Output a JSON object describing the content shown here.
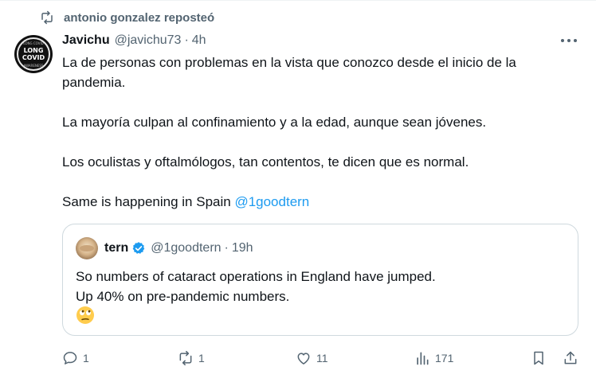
{
  "repost": {
    "icon": "repost-icon",
    "text": "antonio gonzalez reposteó"
  },
  "avatar": {
    "line1": "LONG",
    "line2": "COVID",
    "micro_top": "LONG COVID",
    "micro_bottom": "AWARENESS"
  },
  "tweet": {
    "display_name": "Javichu",
    "handle": "@javichu73",
    "separator": "·",
    "time": "4h",
    "paragraphs": [
      "La de personas con problemas en la vista que conozco desde el inicio de la pandemia.",
      "La mayoría culpan al confinamiento y a la edad, aunque sean jóvenes.",
      "Los oculistas y oftalmólogos, tan contentos, te dicen que es normal."
    ],
    "last_line_text": "Same is happening in Spain ",
    "mention": "@1goodtern"
  },
  "quote": {
    "display_name": "tern",
    "verified_icon": "verified-badge-icon",
    "handle": "@1goodtern",
    "separator": "·",
    "time": "19h",
    "line1": "So numbers of cataract operations in England have jumped.",
    "line2": "Up 40% on pre-pandemic numbers.",
    "emoji": "face-with-rolling-eyes-emoji"
  },
  "actions": {
    "reply": {
      "icon": "reply-icon",
      "count": "1"
    },
    "repost": {
      "icon": "repost-icon",
      "count": "1"
    },
    "like": {
      "icon": "heart-icon",
      "count": "11"
    },
    "views": {
      "icon": "views-chart-icon",
      "count": "171"
    },
    "bookmark": {
      "icon": "bookmark-icon"
    },
    "share": {
      "icon": "share-icon"
    }
  },
  "colors": {
    "text": "#0f1419",
    "secondary": "#536471",
    "link": "#1d9bf0",
    "border": "#cfd9de"
  }
}
